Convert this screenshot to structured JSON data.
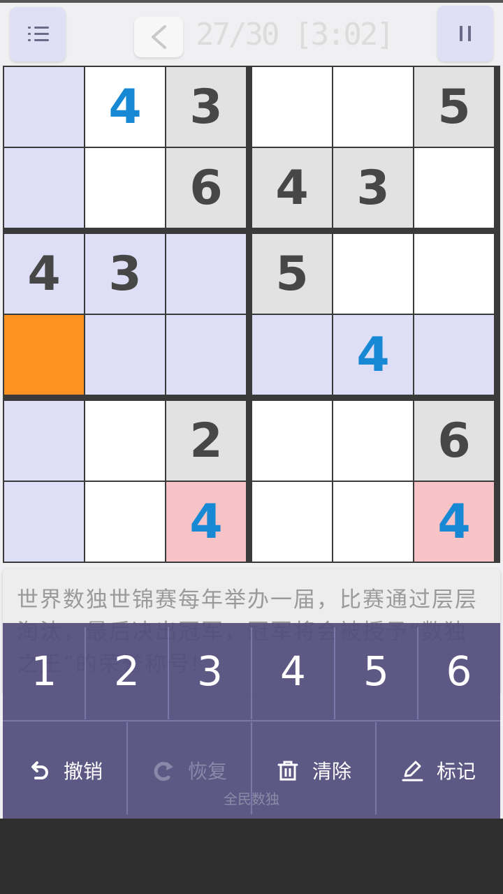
{
  "header": {
    "progress": "27/30",
    "timer": "[3:02]",
    "menu_icon": "menu-icon",
    "back_icon": "chevron-left-icon",
    "pause_icon": "pause-icon"
  },
  "colors": {
    "given": "#474747",
    "entered": "#1788d4",
    "selected": "#ff9122",
    "highlight": "#dedef7",
    "conflict": "#f7c3c6",
    "shaded": "#e2e2e2",
    "white": "#ffffff"
  },
  "board": {
    "size": 6,
    "box_rows": 2,
    "box_cols": 3,
    "cells": [
      [
        {
          "v": "",
          "s": "highlight"
        },
        {
          "v": "4",
          "t": "entered",
          "s": "white"
        },
        {
          "v": "3",
          "t": "given",
          "s": "shaded"
        },
        {
          "v": "",
          "s": "white"
        },
        {
          "v": "",
          "s": "white"
        },
        {
          "v": "5",
          "t": "given",
          "s": "shaded"
        }
      ],
      [
        {
          "v": "",
          "s": "highlight"
        },
        {
          "v": "",
          "s": "white"
        },
        {
          "v": "6",
          "t": "given",
          "s": "shaded"
        },
        {
          "v": "4",
          "t": "given",
          "s": "shaded"
        },
        {
          "v": "3",
          "t": "given",
          "s": "shaded"
        },
        {
          "v": "",
          "s": "white"
        }
      ],
      [
        {
          "v": "4",
          "t": "given",
          "s": "highlight"
        },
        {
          "v": "3",
          "t": "given",
          "s": "highlight"
        },
        {
          "v": "",
          "s": "highlight"
        },
        {
          "v": "5",
          "t": "given",
          "s": "shaded"
        },
        {
          "v": "",
          "s": "white"
        },
        {
          "v": "",
          "s": "white"
        }
      ],
      [
        {
          "v": "",
          "s": "selected"
        },
        {
          "v": "",
          "s": "highlight"
        },
        {
          "v": "",
          "s": "highlight"
        },
        {
          "v": "",
          "s": "highlight"
        },
        {
          "v": "4",
          "t": "entered",
          "s": "highlight"
        },
        {
          "v": "",
          "s": "highlight"
        }
      ],
      [
        {
          "v": "",
          "s": "highlight"
        },
        {
          "v": "",
          "s": "white"
        },
        {
          "v": "2",
          "t": "given",
          "s": "shaded"
        },
        {
          "v": "",
          "s": "white"
        },
        {
          "v": "",
          "s": "white"
        },
        {
          "v": "6",
          "t": "given",
          "s": "shaded"
        }
      ],
      [
        {
          "v": "",
          "s": "highlight"
        },
        {
          "v": "",
          "s": "white"
        },
        {
          "v": "4",
          "t": "entered",
          "s": "conflict"
        },
        {
          "v": "",
          "s": "white"
        },
        {
          "v": "",
          "s": "white"
        },
        {
          "v": "4",
          "t": "entered",
          "s": "conflict"
        }
      ]
    ]
  },
  "hint": {
    "text": "世界数独世锦赛每年举办一届，比赛通过层层淘汰，最后决出冠军，冠军将会被授予“数独之王”的荣誉称号!"
  },
  "keypad": {
    "numbers": [
      "1",
      "2",
      "3",
      "4",
      "5",
      "6"
    ],
    "actions": {
      "undo": {
        "label": "撤销",
        "icon": "undo-icon"
      },
      "redo": {
        "label": "恢复",
        "icon": "redo-icon"
      },
      "clear": {
        "label": "清除",
        "icon": "trash-icon"
      },
      "mark": {
        "label": "标记",
        "icon": "pencil-icon"
      }
    }
  },
  "watermark": "全民数独"
}
